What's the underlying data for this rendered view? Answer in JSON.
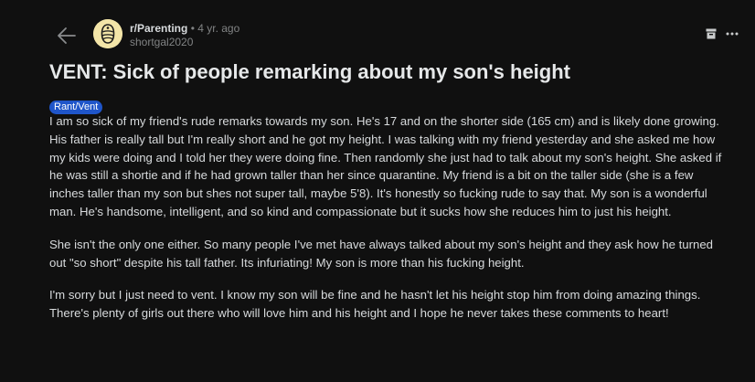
{
  "post": {
    "subreddit": "r/Parenting",
    "separator": "•",
    "age": "4 yr. ago",
    "author": "shortgal2020",
    "title": "VENT: Sick of people remarking about my son's height",
    "flair": "Rant/Vent",
    "paragraphs": [
      "I am so sick of my friend's rude remarks towards my son. He's 17 and on the shorter side (165 cm) and is likely done growing. His father is really tall but I'm really short and he got my height. I was talking with my friend yesterday and she asked me how my kids were doing and I told her they were doing fine. Then randomly she just had to talk about my son's height. She asked if he was still a shortie and if he had grown taller than her since quarantine. My friend is a bit on the taller side (she is a few inches taller than my son but shes not super tall, maybe 5'8). It's honestly so fucking rude to say that. My son is a wonderful man. He's handsome, intelligent, and so kind and compassionate but it sucks how she reduces him to just his height.",
      "She isn't the only one either. So many people I've met have always talked about my son's height and they ask how he turned out \"so short\" despite his tall father. Its infuriating! My son is more than his fucking height.",
      "I'm sorry but I just need to vent. I know my son will be fine and he hasn't let his height stop him from doing amazing things. There's plenty of girls out there who will love him and his height and I hope he never takes these comments to heart!"
    ]
  },
  "icons": {
    "back": "back-arrow-icon",
    "avatar": "subreddit-avatar-icon",
    "archive": "archive-icon",
    "more": "more-options-icon"
  },
  "colors": {
    "background": "#101010",
    "text": "#d7dadc",
    "muted": "#818384",
    "flair_bg": "#1f55c9",
    "avatar_bg": "#f3e5a8"
  }
}
